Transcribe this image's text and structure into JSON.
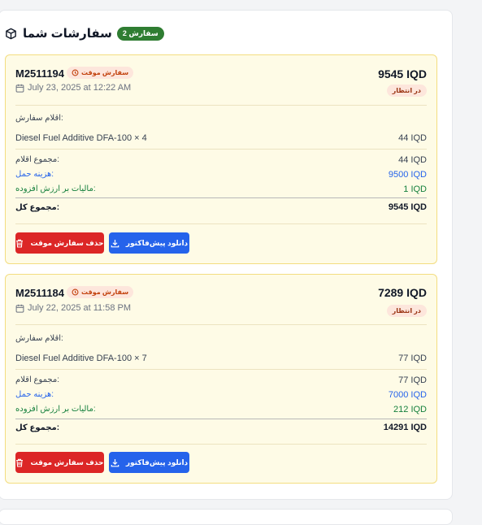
{
  "header": {
    "title": "سفارشات شما",
    "count_badge": "سفارش 2"
  },
  "orders": [
    {
      "id": "M2511194",
      "temp_badge": "سفارش موقت",
      "date": "July 23, 2025 at 12:22 AM",
      "total": "9545 IQD",
      "status": "در انتظار",
      "items_title": "اقلام سفارش:",
      "item_name": "Diesel Fuel Additive DFA-100 × 4",
      "item_price": "44 IQD",
      "items_sum_label": "مجموع اقلام:",
      "items_sum_value": "44 IQD",
      "shipping_label": "هزینه حمل:",
      "shipping_value": "9500 IQD",
      "vat_label": "مالیات بر ارزش افزوده:",
      "vat_value": "1 IQD",
      "grand_label": "مجموع کل:",
      "grand_value": "9545 IQD",
      "download_label": "دانلود پیش‌فاکتور",
      "delete_label": "حذف سفارش موقت"
    },
    {
      "id": "M2511184",
      "temp_badge": "سفارش موقت",
      "date": "July 22, 2025 at 11:58 PM",
      "total": "7289 IQD",
      "status": "در انتظار",
      "items_title": "اقلام سفارش:",
      "item_name": "Diesel Fuel Additive DFA-100 × 7",
      "item_price": "77 IQD",
      "items_sum_label": "مجموع اقلام:",
      "items_sum_value": "77 IQD",
      "shipping_label": "هزینه حمل:",
      "shipping_value": "7000 IQD",
      "vat_label": "مالیات بر ارزش افزوده:",
      "vat_value": "212 IQD",
      "grand_label": "مجموع کل:",
      "grand_value": "14291 IQD",
      "download_label": "دانلود پیش‌فاکتور",
      "delete_label": "حذف سفارش موقت"
    }
  ],
  "icons": {
    "header": "package-icon",
    "temp": "clock-icon",
    "date": "calendar-icon",
    "download": "download-icon",
    "delete": "trash-icon"
  },
  "colors": {
    "card_bg": "#fefbe6",
    "card_border": "#f3dd80",
    "count_badge": "#2f7d32",
    "temp_badge_bg": "#fde6dc",
    "delete_button": "#dc2626",
    "download_button": "#2563eb",
    "shipping_text": "#2563eb",
    "vat_text": "#15803d"
  }
}
